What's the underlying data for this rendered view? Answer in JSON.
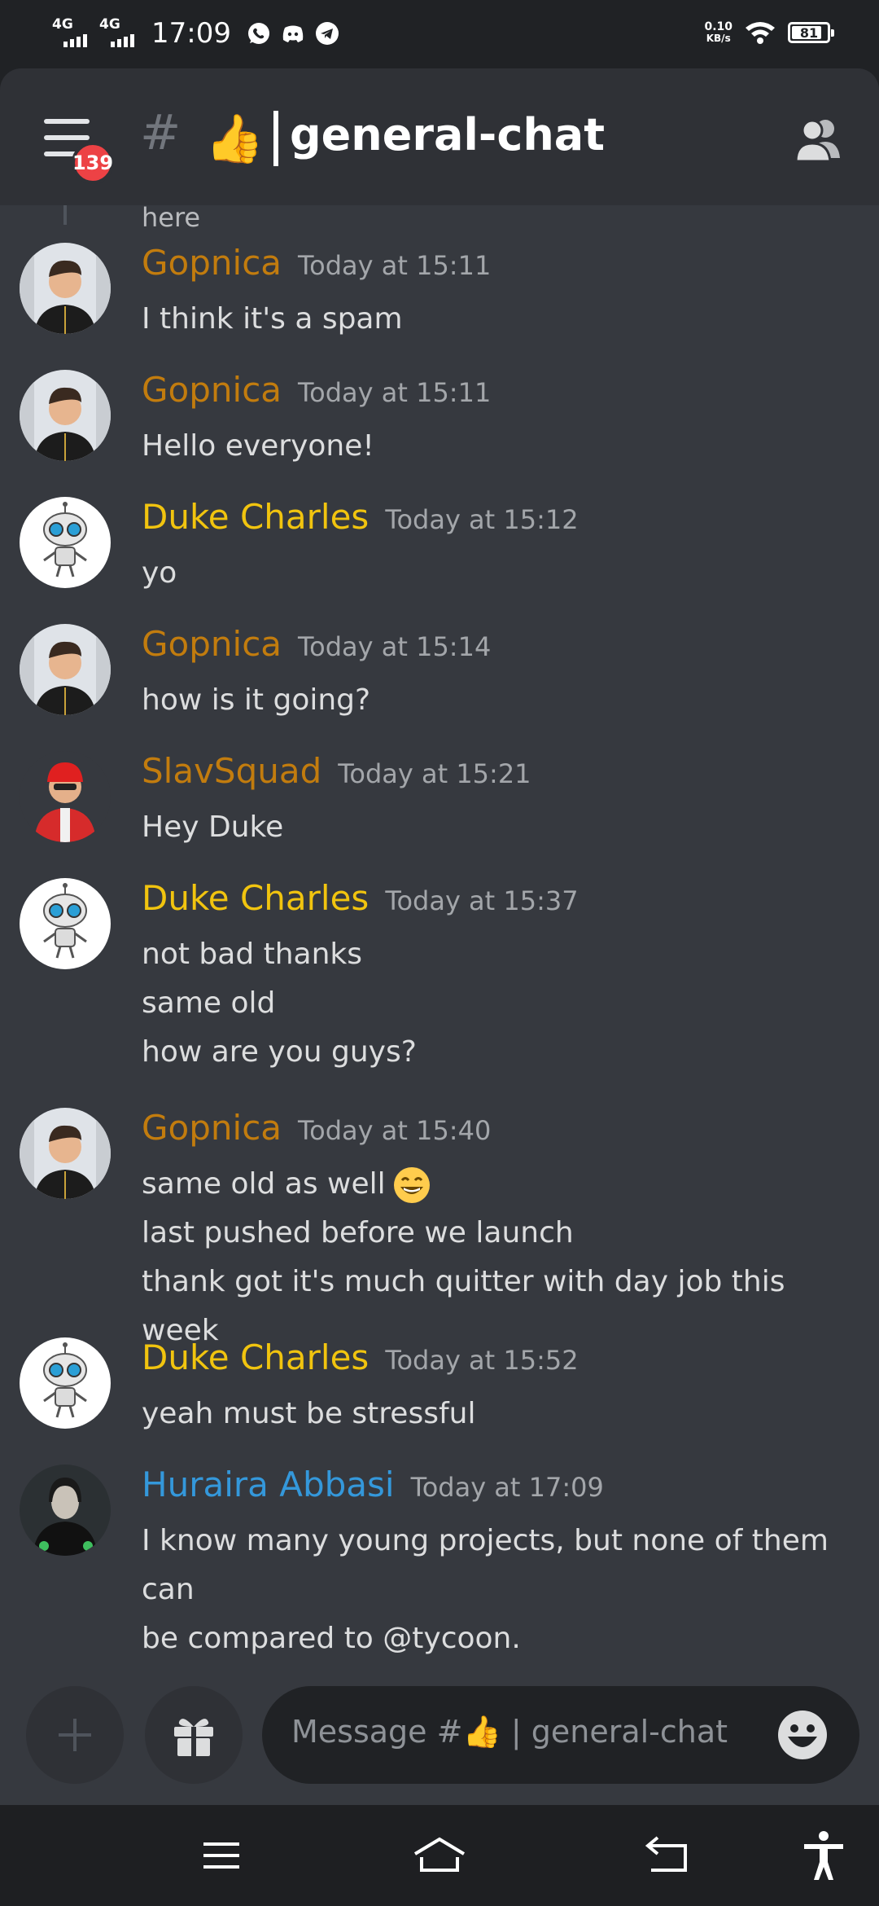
{
  "status_bar": {
    "network1": "4G",
    "network2": "4G",
    "time": "17:09",
    "speed_value": "0.10",
    "speed_unit": "KB/s",
    "battery": "81"
  },
  "header": {
    "notification_count": "139",
    "hash": "#",
    "channel_emoji": "👍",
    "channel_name": "general-chat"
  },
  "chat": {
    "prev_text": "here",
    "messages": [
      {
        "author": "Gopnica",
        "author_color": "#c27c0e",
        "avatar": "gopnica-avatar",
        "timestamp": "Today at 15:11",
        "lines": [
          "I think it's a spam"
        ]
      },
      {
        "author": "Gopnica",
        "author_color": "#c27c0e",
        "avatar": "gopnica-avatar",
        "timestamp": "Today at 15:11",
        "lines": [
          "Hello everyone!"
        ]
      },
      {
        "author": "Duke Charles",
        "author_color": "#f1c40f",
        "avatar": "robot-avatar",
        "timestamp": "Today at 15:12",
        "lines": [
          "yo"
        ]
      },
      {
        "author": "Gopnica",
        "author_color": "#c27c0e",
        "avatar": "gopnica-avatar",
        "timestamp": "Today at 15:14",
        "lines": [
          "how is it going?"
        ]
      },
      {
        "author": "SlavSquad",
        "author_color": "#c27c0e",
        "avatar": "slavsquad-avatar",
        "timestamp": "Today at 15:21",
        "lines": [
          "Hey Duke"
        ]
      },
      {
        "author": "Duke Charles",
        "author_color": "#f1c40f",
        "avatar": "robot-avatar",
        "timestamp": "Today at 15:37",
        "lines": [
          "not bad thanks",
          "same old",
          "how are you guys?"
        ]
      },
      {
        "author": "Gopnica",
        "author_color": "#c27c0e",
        "avatar": "gopnica-avatar",
        "timestamp": "Today at 15:40",
        "lines": [
          "same old as well",
          "last pushed before we launch",
          "thank got it's much quitter with day job this week"
        ]
      },
      {
        "author": "Duke Charles",
        "author_color": "#f1c40f",
        "avatar": "robot-avatar",
        "timestamp": "Today at 15:52",
        "lines": [
          "yeah must be stressful"
        ]
      },
      {
        "author": "Huraira Abbasi",
        "author_color": "#3498db",
        "avatar": "huraira-avatar",
        "timestamp": "Today at 17:09",
        "lines": [
          "I know many young projects, but none of them can",
          "be compared to @tycoon."
        ]
      }
    ]
  },
  "input": {
    "placeholder": "Message #👍 | general-chat"
  },
  "icons": {
    "menu": "hamburger-menu-icon",
    "members": "members-icon",
    "add": "plus-icon",
    "gift": "gift-icon",
    "emoji": "emoji-icon",
    "nav": [
      "recents-icon",
      "home-icon",
      "back-icon",
      "accessibility-icon"
    ]
  }
}
